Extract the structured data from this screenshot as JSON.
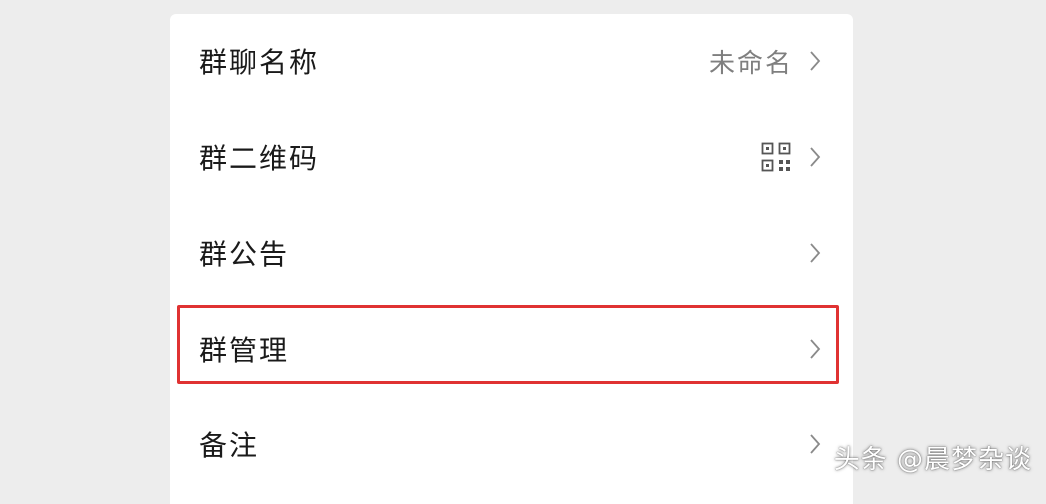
{
  "settings": {
    "items": [
      {
        "label": "群聊名称",
        "value": "未命名"
      },
      {
        "label": "群二维码",
        "icon": "qr-code-icon"
      },
      {
        "label": "群公告"
      },
      {
        "label": "群管理"
      },
      {
        "label": "备注"
      }
    ]
  },
  "watermark": "头条 @晨梦杂谈",
  "colors": {
    "highlight": "#e03232",
    "background": "#ededed",
    "card": "#ffffff",
    "label": "#1a1a1a",
    "secondary": "#7f7f7f"
  }
}
